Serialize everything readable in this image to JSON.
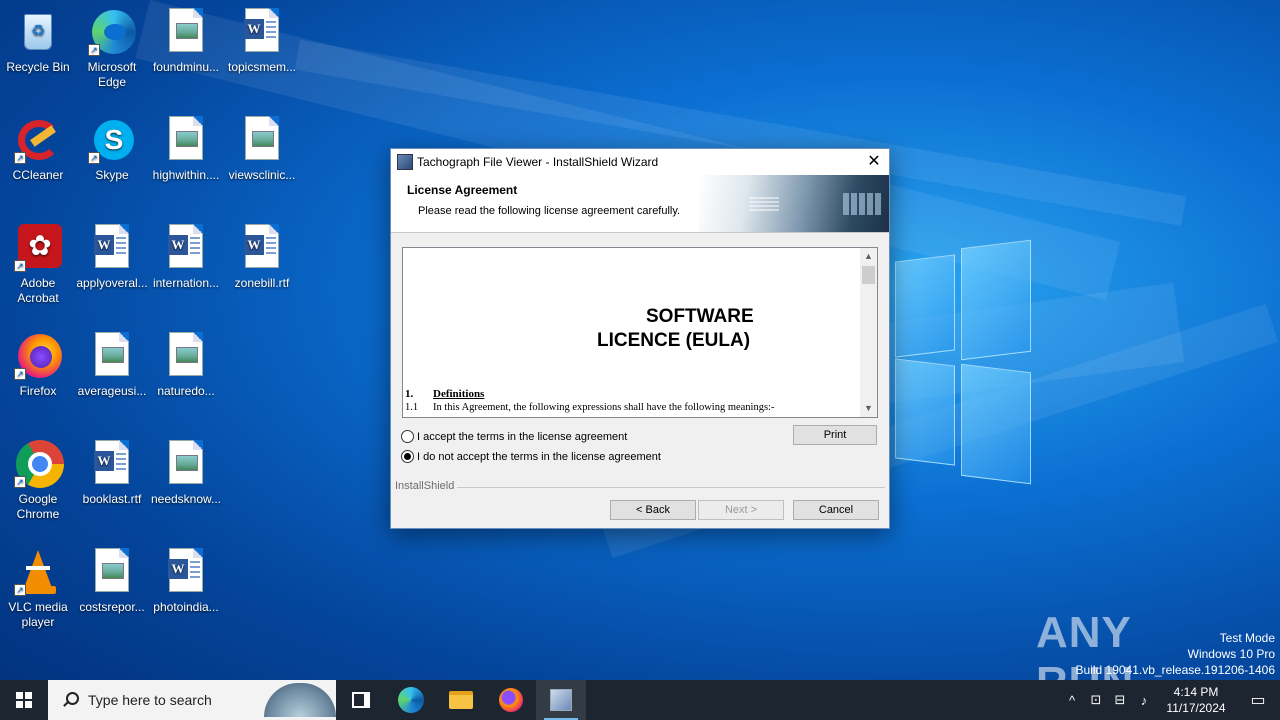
{
  "desktop": {
    "icons": [
      {
        "label": "Recycle Bin"
      },
      {
        "label": "Microsoft Edge"
      },
      {
        "label": "foundminu..."
      },
      {
        "label": "topicsmem..."
      },
      {
        "label": "CCleaner"
      },
      {
        "label": "Skype"
      },
      {
        "label": "highwithin...."
      },
      {
        "label": "viewsclinic..."
      },
      {
        "label": "Adobe Acrobat"
      },
      {
        "label": "applyoveral..."
      },
      {
        "label": "internation..."
      },
      {
        "label": "zonebill.rtf"
      },
      {
        "label": "Firefox"
      },
      {
        "label": "averageusi..."
      },
      {
        "label": "naturedo..."
      },
      {
        "label": "Google Chrome"
      },
      {
        "label": "booklast.rtf"
      },
      {
        "label": "needsknow..."
      },
      {
        "label": "VLC media player"
      },
      {
        "label": "costsrepor..."
      },
      {
        "label": "photoindia..."
      }
    ]
  },
  "dialog": {
    "title": "Tachograph File Viewer - InstallShield Wizard",
    "close_glyph": "✕",
    "banner_title": "License Agreement",
    "banner_subtitle": "Please read the following license agreement carefully.",
    "license": {
      "heading_line1": "SOFTWARE",
      "heading_line2": "LICENCE (EULA)",
      "section_number": "1.",
      "section_title": "Definitions",
      "line_number": "1.1",
      "line_text": "In this Agreement, the following expressions shall have the following meanings:-"
    },
    "radio_accept": "I accept the terms in the license agreement",
    "radio_decline": "I do not accept the terms in the license agreement",
    "print_label": "Print",
    "group_label": "InstallShield",
    "back_label": "< Back",
    "next_label": "Next >",
    "cancel_label": "Cancel"
  },
  "watermark": {
    "text": "ANY RUN",
    "test_mode": "Test Mode",
    "edition": "Windows 10 Pro",
    "build": "Build 19041.vb_release.191206-1406"
  },
  "taskbar": {
    "search_placeholder": "Type here to search",
    "time": "4:14 PM",
    "date": "11/17/2024"
  }
}
